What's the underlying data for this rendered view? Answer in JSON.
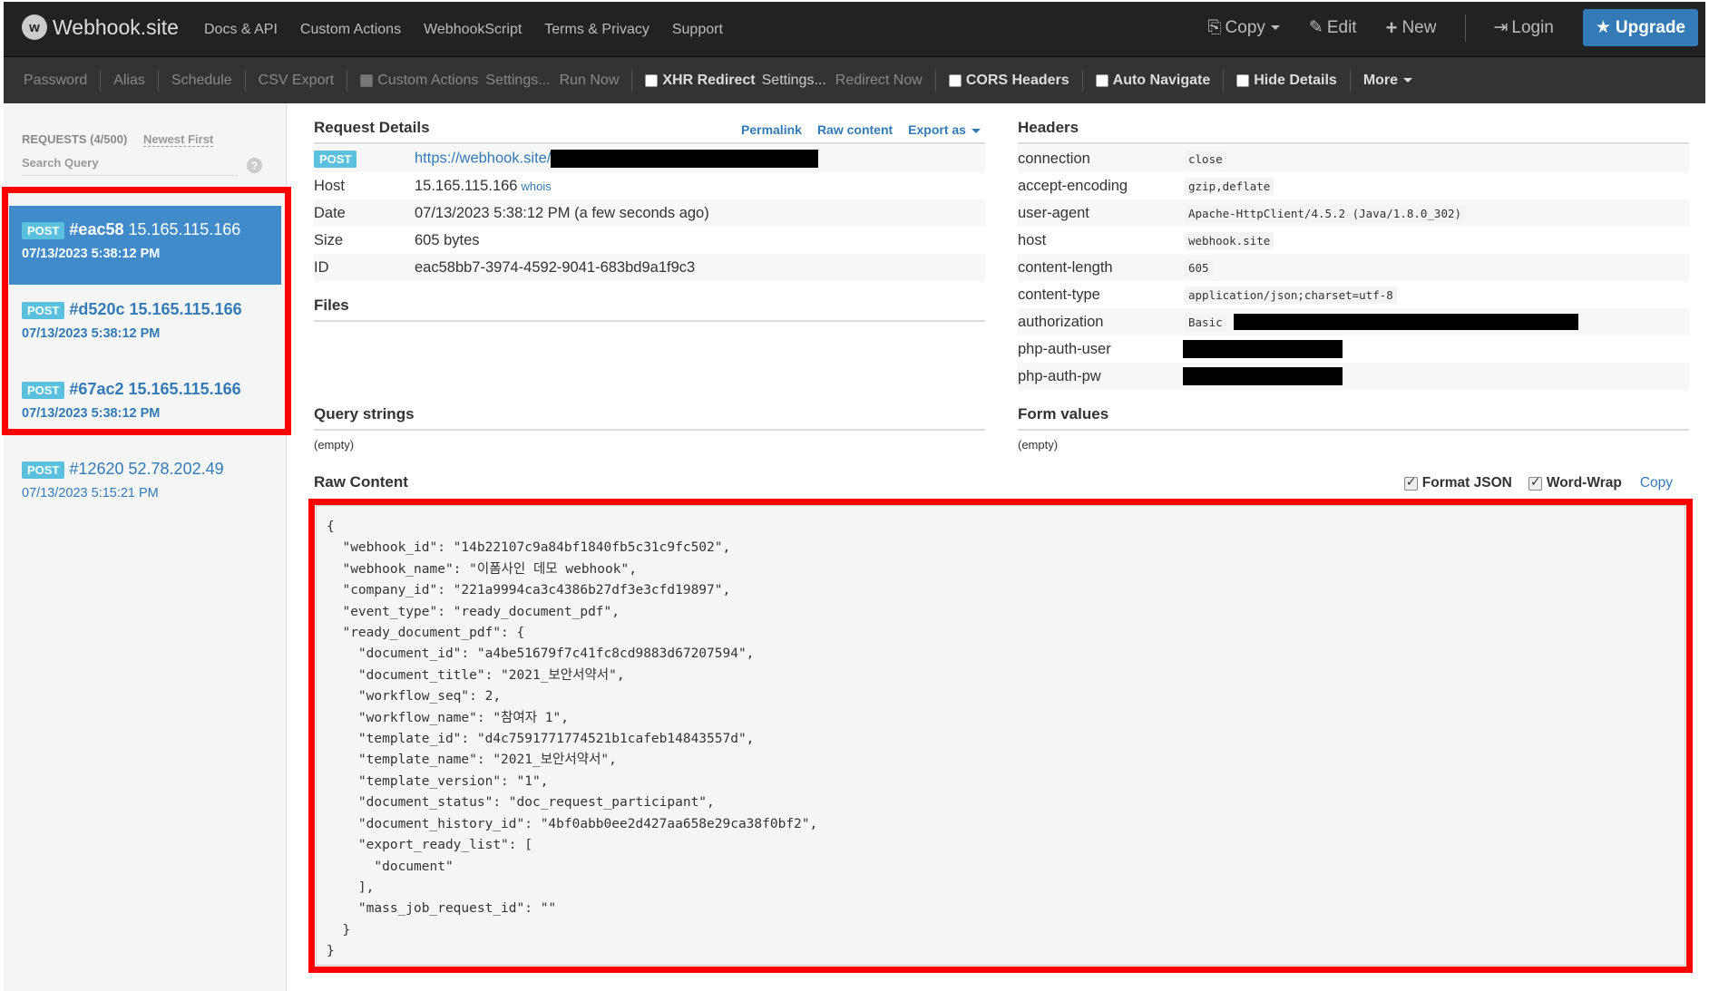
{
  "navbar": {
    "brand": "Webhook.site",
    "links": [
      "Docs & API",
      "Custom Actions",
      "WebhookScript",
      "Terms & Privacy",
      "Support"
    ],
    "copy": "Copy",
    "edit": "Edit",
    "new": "New",
    "login": "Login",
    "upgrade": "Upgrade"
  },
  "toolbar": {
    "password": "Password",
    "alias": "Alias",
    "schedule": "Schedule",
    "csv_export": "CSV Export",
    "custom_actions": "Custom Actions",
    "custom_actions_settings": "Settings...",
    "run_now": "Run Now",
    "xhr_redirect": "XHR Redirect",
    "xhr_settings": "Settings...",
    "redirect_now": "Redirect Now",
    "cors_headers": "CORS Headers",
    "auto_navigate": "Auto Navigate",
    "hide_details": "Hide Details",
    "more": "More"
  },
  "sidebar": {
    "requests_count": "REQUESTS (4/500)",
    "sort": "Newest First",
    "search_placeholder": "Search Query",
    "requests": [
      {
        "method": "POST",
        "id": "#eac58",
        "ip": "15.165.115.166",
        "date": "07/13/2023 5:38:12 PM"
      },
      {
        "method": "POST",
        "id": "#d520c",
        "ip": "15.165.115.166",
        "date": "07/13/2023 5:38:12 PM"
      },
      {
        "method": "POST",
        "id": "#67ac2",
        "ip": "15.165.115.166",
        "date": "07/13/2023 5:38:12 PM"
      },
      {
        "method": "POST",
        "id": "#12620",
        "ip": "52.78.202.49",
        "date": "07/13/2023 5:15:21 PM"
      }
    ]
  },
  "request_details": {
    "title": "Request Details",
    "permalink": "Permalink",
    "raw_content": "Raw content",
    "export_as": "Export as",
    "method": "POST",
    "url": "https://webhook.site/",
    "host_label": "Host",
    "host": "15.165.115.166",
    "whois": "whois",
    "date_label": "Date",
    "date": "07/13/2023 5:38:12 PM (a few seconds ago)",
    "size_label": "Size",
    "size": "605 bytes",
    "id_label": "ID",
    "id": "eac58bb7-3974-4592-9041-683bd9a1f9c3"
  },
  "files": {
    "title": "Files"
  },
  "query_strings": {
    "title": "Query strings",
    "value": "(empty)"
  },
  "headers": {
    "title": "Headers",
    "rows": [
      {
        "key": "connection",
        "value": "close"
      },
      {
        "key": "accept-encoding",
        "value": "gzip,deflate"
      },
      {
        "key": "user-agent",
        "value": "Apache-HttpClient/4.5.2 (Java/1.8.0_302)"
      },
      {
        "key": "host",
        "value": "webhook.site"
      },
      {
        "key": "content-length",
        "value": "605"
      },
      {
        "key": "content-type",
        "value": "application/json;charset=utf-8"
      },
      {
        "key": "authorization",
        "value": "Basic"
      },
      {
        "key": "php-auth-user",
        "value": ""
      },
      {
        "key": "php-auth-pw",
        "value": ""
      }
    ]
  },
  "form_values": {
    "title": "Form values",
    "value": "(empty)"
  },
  "raw": {
    "title": "Raw Content",
    "format_json": "Format JSON",
    "word_wrap": "Word-Wrap",
    "copy": "Copy",
    "content": "{\n  \"webhook_id\": \"14b22107c9a84bf1840fb5c31c9fc502\",\n  \"webhook_name\": \"이폼사인 데모 webhook\",\n  \"company_id\": \"221a9994ca3c4386b27df3e3cfd19897\",\n  \"event_type\": \"ready_document_pdf\",\n  \"ready_document_pdf\": {\n    \"document_id\": \"a4be51679f7c41fc8cd9883d67207594\",\n    \"document_title\": \"2021_보안서약서\",\n    \"workflow_seq\": 2,\n    \"workflow_name\": \"참여자 1\",\n    \"template_id\": \"d4c7591771774521b1cafeb14843557d\",\n    \"template_name\": \"2021_보안서약서\",\n    \"template_version\": \"1\",\n    \"document_status\": \"doc_request_participant\",\n    \"document_history_id\": \"4bf0abb0ee2d427aa658e29ca38f0bf2\",\n    \"export_ready_list\": [\n      \"document\"\n    ],\n    \"mass_job_request_id\": \"\"\n  }\n}"
  }
}
